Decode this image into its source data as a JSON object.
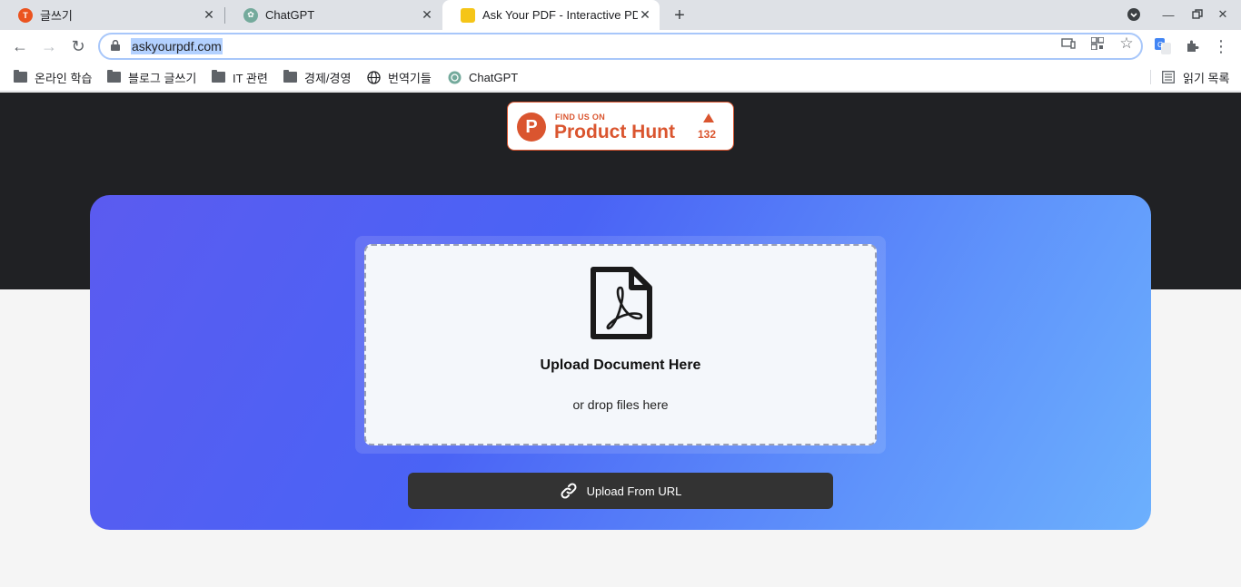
{
  "browser": {
    "tabs": [
      {
        "title": "글쓰기",
        "favicon": "tistory-icon",
        "color": "#eb531f",
        "active": false
      },
      {
        "title": "ChatGPT",
        "favicon": "chatgpt-icon",
        "color": "#74aa9c",
        "active": false
      },
      {
        "title": "Ask Your PDF - Interactive PDF",
        "favicon": "askyourpdf-icon",
        "color": "#f5c518",
        "active": true
      }
    ],
    "url": "askyourpdf.com",
    "bookmarks": [
      {
        "label": "온라인 학습",
        "icon": "folder-icon"
      },
      {
        "label": "블로그 글쓰기",
        "icon": "folder-icon"
      },
      {
        "label": "IT 관련",
        "icon": "folder-icon"
      },
      {
        "label": "경제/경영",
        "icon": "folder-icon"
      },
      {
        "label": "번역기들",
        "icon": "globe-icon"
      },
      {
        "label": "ChatGPT",
        "icon": "chatgpt-icon"
      }
    ],
    "reading_list": "읽기 목록"
  },
  "product_hunt": {
    "small": "FIND US ON",
    "big": "Product Hunt",
    "count": "132",
    "color": "#da552f"
  },
  "upload": {
    "title": "Upload Document Here",
    "subtitle": "or drop files here",
    "url_button": "Upload From URL"
  }
}
